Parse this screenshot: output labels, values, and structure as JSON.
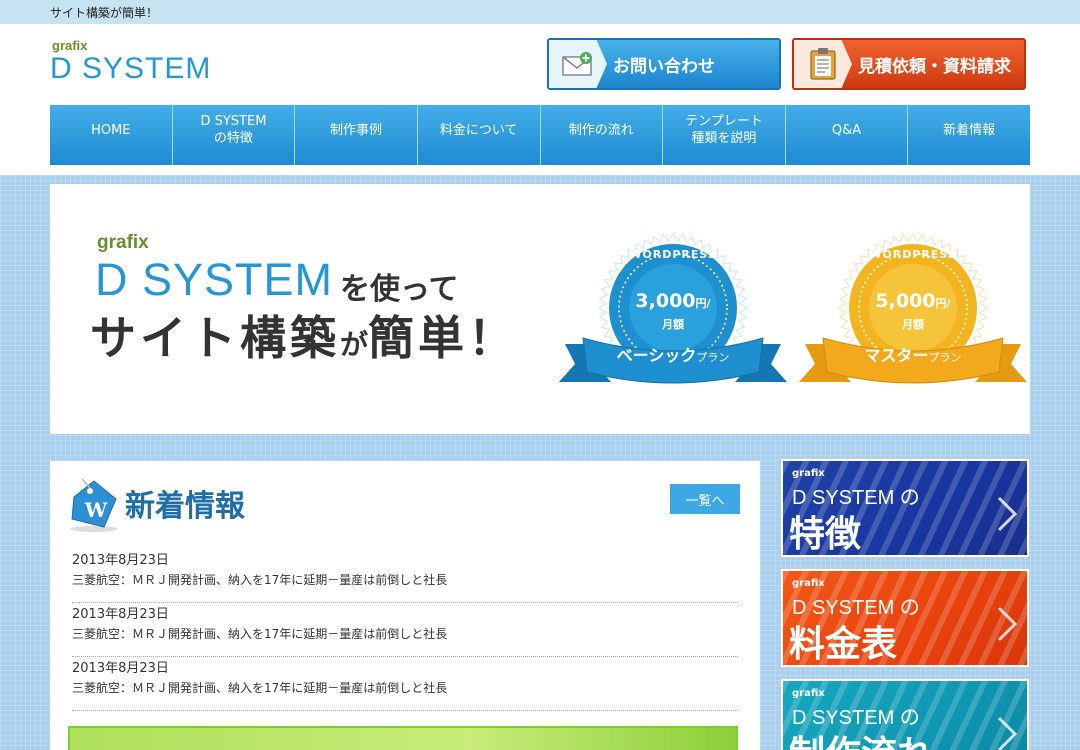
{
  "topbar": {
    "text": "サイト構築が簡単！"
  },
  "logo": {
    "small": "grafix",
    "main": "D SYSTEM"
  },
  "header_buttons": {
    "contact": "お問い合わせ",
    "quote": "見積依頼・資料請求"
  },
  "nav": [
    {
      "label": "HOME"
    },
    {
      "label": "D SYSTEM\nの特徴"
    },
    {
      "label": "制作事例"
    },
    {
      "label": "料金について"
    },
    {
      "label": "制作の流れ"
    },
    {
      "label": "テンプレート\n種類を説明"
    },
    {
      "label": "Q&A"
    },
    {
      "label": "新着情報"
    }
  ],
  "hero": {
    "grafix": "grafix",
    "dsystem": "D SYSTEM",
    "suffix": "を使って",
    "line2_a": "サイト構築",
    "line2_b": "が",
    "line2_c": "簡単！"
  },
  "badges": [
    {
      "top": "WORDPRESS",
      "price": "3,000",
      "per": "円/",
      "unit": "月額",
      "name": "ベーシック",
      "name_suffix": "プラン",
      "color": "#1e8fcf",
      "ribbon": "#1477b3"
    },
    {
      "top": "WORDPRESS",
      "price": "5,000",
      "per": "円/",
      "unit": "月額",
      "name": "マスター",
      "name_suffix": "プラン",
      "color": "#f2b520",
      "ribbon": "#e69a12"
    }
  ],
  "news": {
    "title": "新着情報",
    "more": "一覧へ",
    "items": [
      {
        "date": "2013年8月23日",
        "text": "三菱航空：ＭＲＪ開発計画、納入を17年に延期－量産は前倒しと社長"
      },
      {
        "date": "2013年8月23日",
        "text": "三菱航空：ＭＲＪ開発計画、納入を17年に延期－量産は前倒しと社長"
      },
      {
        "date": "2013年8月23日",
        "text": "三菱航空：ＭＲＪ開発計画、納入を17年に延期－量産は前倒しと社長"
      }
    ]
  },
  "side_banners": [
    {
      "grafix": "grafix",
      "ds": "D SYSTEM の",
      "big": "特徴"
    },
    {
      "grafix": "grafix",
      "ds": "D SYSTEM の",
      "big": "料金表"
    },
    {
      "grafix": "grafix",
      "ds": "D SYSTEM の",
      "big": "制作流れ"
    }
  ]
}
